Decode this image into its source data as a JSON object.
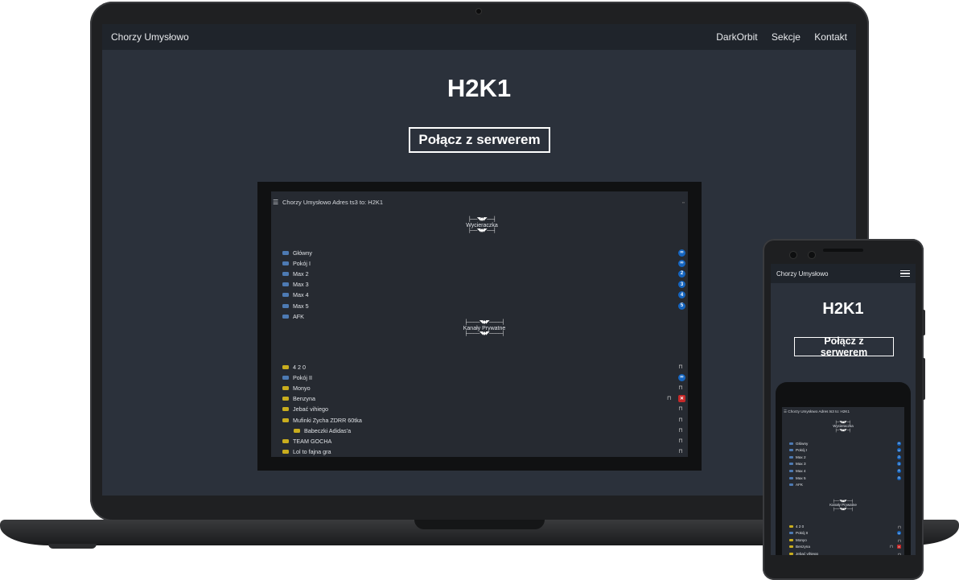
{
  "site": {
    "brand": "Chorzy Umysłowo",
    "nav": [
      "DarkOrbit",
      "Sekcje",
      "Kontakt"
    ],
    "title": "H2K1",
    "connect_label": "Połącz z serwerem"
  },
  "viewer": {
    "header": "Chorzy Umysłowo Adres ts3 to: H2K1",
    "separators": [
      "Wycieraczka",
      "Kanały Prywatne"
    ],
    "public_channels": [
      {
        "name": "Główny",
        "badge": "∞"
      },
      {
        "name": "Pokój I",
        "badge": "∞"
      },
      {
        "name": "Max 2",
        "badge": "2"
      },
      {
        "name": "Max 3",
        "badge": "3"
      },
      {
        "name": "Max 4",
        "badge": "4"
      },
      {
        "name": "Max 5",
        "badge": "5"
      },
      {
        "name": "AFK",
        "badge": ""
      }
    ],
    "private_channels": [
      {
        "name": "4 2 0",
        "icon": "yellow",
        "badge": "lock"
      },
      {
        "name": "Pokój II",
        "icon": "blue",
        "badge": "∞"
      },
      {
        "name": "Monyo",
        "icon": "yellow",
        "badge": "lock"
      },
      {
        "name": "Benzyna",
        "icon": "yellow",
        "badge": "red"
      },
      {
        "name": "Jebać vihiego",
        "icon": "yellow",
        "badge": "lock"
      },
      {
        "name": "Mufinki Zycha ZDRR 60tka",
        "icon": "yellow",
        "badge": "lock"
      },
      {
        "name": "Babeczki Adidas'a",
        "icon": "yellow",
        "badge": "lock",
        "indent": true
      },
      {
        "name": "TEAM GOCHA",
        "icon": "yellow",
        "badge": "lock"
      },
      {
        "name": "Lol to fajna gra",
        "icon": "yellow",
        "badge": "lock"
      }
    ]
  },
  "colors": {
    "page_bg": "#2b313b",
    "navbar_bg": "#1f242b",
    "badge_blue": "#1565c0",
    "badge_red": "#c62828",
    "channel_blue": "#4d7ab3",
    "channel_yellow": "#c9ad1e"
  },
  "icons": {
    "menu": "hamburger-icon",
    "lock": "lock-icon",
    "channel": "speech-bubble-icon"
  }
}
